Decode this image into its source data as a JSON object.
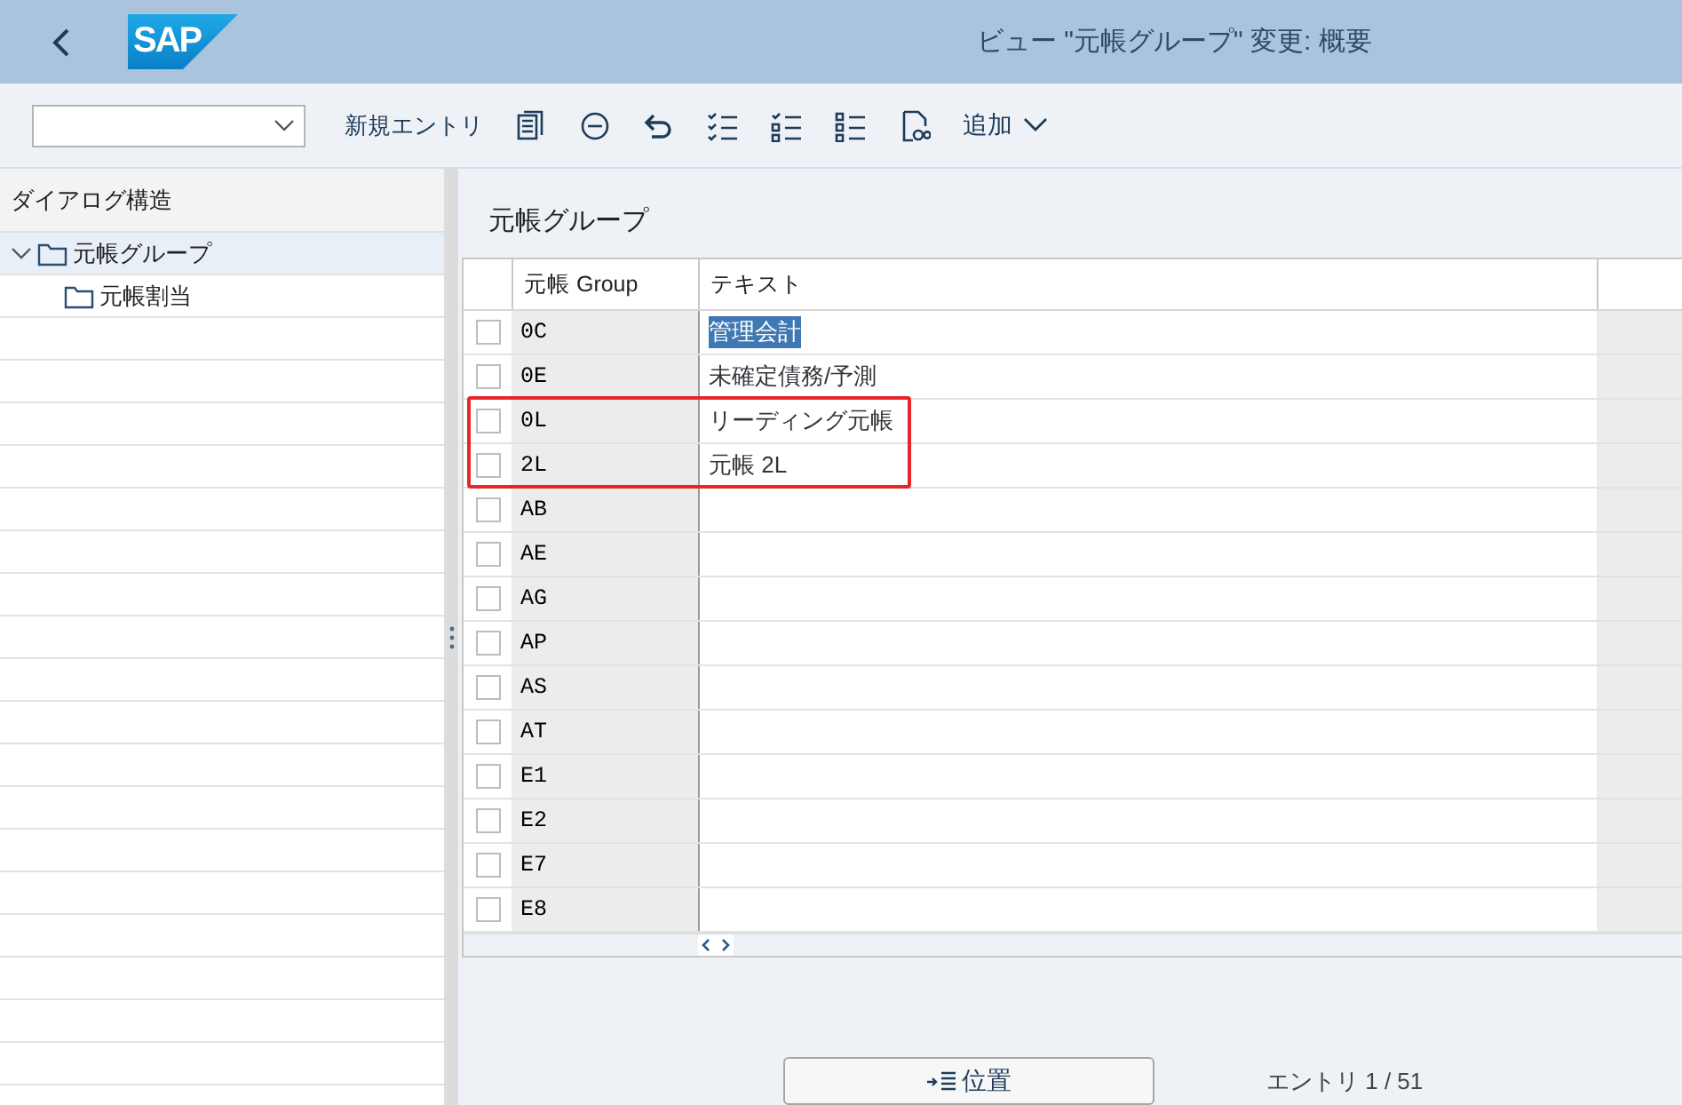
{
  "header": {
    "logo": "SAP",
    "title": "ビュー \"元帳グループ\" 変更: 概要"
  },
  "toolbar": {
    "new_entries": "新規エントリ",
    "more": "追加"
  },
  "sidebar": {
    "title": "ダイアログ構造",
    "tree": [
      {
        "label": "元帳グループ",
        "expanded": true,
        "selected": true,
        "children": [
          {
            "label": "元帳割当",
            "selected": false
          }
        ]
      }
    ]
  },
  "panel_title": "元帳グループ",
  "table": {
    "columns": [
      "元帳 Group",
      "テキスト"
    ],
    "rows": [
      {
        "group": "0C",
        "text": "管理会計",
        "checked": false,
        "selected": true,
        "highlighted": false
      },
      {
        "group": "0E",
        "text": "未確定債務/予測",
        "checked": false,
        "selected": false,
        "highlighted": false
      },
      {
        "group": "0L",
        "text": "リーディング元帳",
        "checked": false,
        "selected": false,
        "highlighted": true
      },
      {
        "group": "2L",
        "text": "元帳 2L",
        "checked": false,
        "selected": false,
        "highlighted": true
      },
      {
        "group": "AB",
        "checked": false,
        "highlighted": false
      },
      {
        "group": "AE",
        "checked": false,
        "highlighted": false
      },
      {
        "group": "AG",
        "checked": false,
        "highlighted": false
      },
      {
        "group": "AP",
        "checked": false,
        "highlighted": false
      },
      {
        "group": "AS",
        "checked": false,
        "highlighted": false
      },
      {
        "group": "AT",
        "checked": false,
        "highlighted": false
      },
      {
        "group": "E1",
        "checked": false,
        "highlighted": false
      },
      {
        "group": "E2",
        "checked": false,
        "highlighted": false
      },
      {
        "group": "E7",
        "checked": false,
        "highlighted": false
      },
      {
        "group": "E8",
        "checked": false,
        "highlighted": false
      }
    ]
  },
  "footer": {
    "position_button": "位置",
    "entry_count": "エントリ 1 / 51"
  }
}
